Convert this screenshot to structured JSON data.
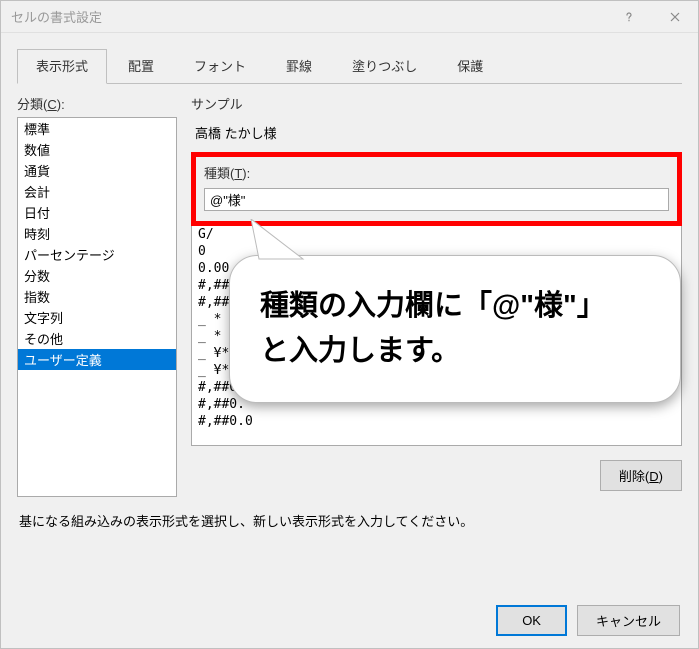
{
  "window": {
    "title": "セルの書式設定"
  },
  "tabs": [
    "表示形式",
    "配置",
    "フォント",
    "罫線",
    "塗りつぶし",
    "保護"
  ],
  "active_tab": 0,
  "category": {
    "label": "分類(C):",
    "items": [
      "標準",
      "数値",
      "通貨",
      "会計",
      "日付",
      "時刻",
      "パーセンテージ",
      "分数",
      "指数",
      "文字列",
      "その他",
      "ユーザー定義"
    ],
    "selected": 11
  },
  "sample": {
    "label": "サンプル",
    "value": "高橋 たかし様"
  },
  "type": {
    "label": "種類(T):",
    "value": "@\"様\""
  },
  "formats": [
    "G/",
    "0",
    "0.00",
    "#,##",
    "#,##0",
    "_ * #,#",
    "_ * #,#",
    "_ ¥* #,",
    "_ ¥* #,",
    "#,##0",
    "#,##0.",
    "#,##0.0"
  ],
  "buttons": {
    "delete": "削除(D)",
    "ok": "OK",
    "cancel": "キャンセル"
  },
  "help_text": "基になる組み込みの表示形式を選択し、新しい表示形式を入力してください。",
  "callout": {
    "line1": "種類の入力欄に「@\"様\"」",
    "line2": "と入力します。"
  }
}
